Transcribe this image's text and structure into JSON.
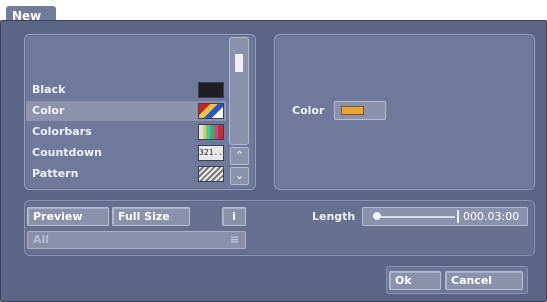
{
  "dialog": {
    "title": "New"
  },
  "list": {
    "items": [
      {
        "label": "Black",
        "thumb": "black-swatch"
      },
      {
        "label": "Color",
        "thumb": "color-swatch",
        "selected": true
      },
      {
        "label": "Colorbars",
        "thumb": "colorbars-swatch"
      },
      {
        "label": "Countdown",
        "thumb": "countdown-swatch",
        "thumb_text": "321.."
      },
      {
        "label": "Pattern",
        "thumb": "pattern-swatch"
      }
    ]
  },
  "properties": {
    "color_label": "Color",
    "color_value": "#e8a23a"
  },
  "controls": {
    "preview_label": "Preview",
    "fullsize_label": "Full Size",
    "info_label": "i",
    "dropdown_value": "All",
    "length_label": "Length",
    "length_value": "000.03:00"
  },
  "footer": {
    "ok_label": "Ok",
    "cancel_label": "Cancel"
  }
}
